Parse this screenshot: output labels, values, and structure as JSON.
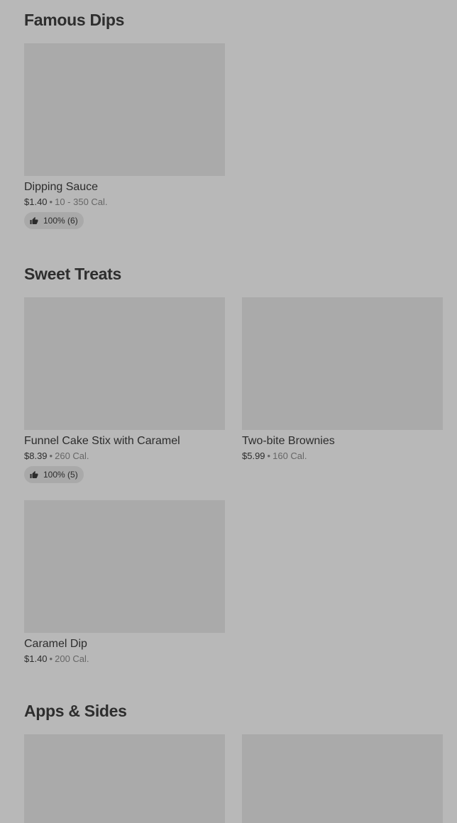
{
  "sections": [
    {
      "title": "Famous Dips",
      "items": [
        {
          "name": "Dipping Sauce",
          "price": "$1.40",
          "calories": "10 - 350 Cal.",
          "rating": "100% (6)"
        }
      ]
    },
    {
      "title": "Sweet Treats",
      "items": [
        {
          "name": "Funnel Cake Stix with Caramel",
          "price": "$8.39",
          "calories": "260 Cal.",
          "rating": "100% (5)"
        },
        {
          "name": "Two-bite Brownies",
          "price": "$5.99",
          "calories": "160 Cal."
        },
        {
          "name": "Caramel Dip",
          "price": "$1.40",
          "calories": "200 Cal."
        }
      ]
    },
    {
      "title": "Apps & Sides",
      "items": [
        {},
        {}
      ]
    }
  ],
  "separator": "•",
  "icons": {
    "rating": "thumbs-up-icon"
  },
  "colors": {
    "background": "#b8b8b8",
    "image_placeholder": "#aaaaaa",
    "rating_pill": "#a9a9a9",
    "text_primary": "#2c2c2c",
    "text_secondary": "#666666"
  }
}
